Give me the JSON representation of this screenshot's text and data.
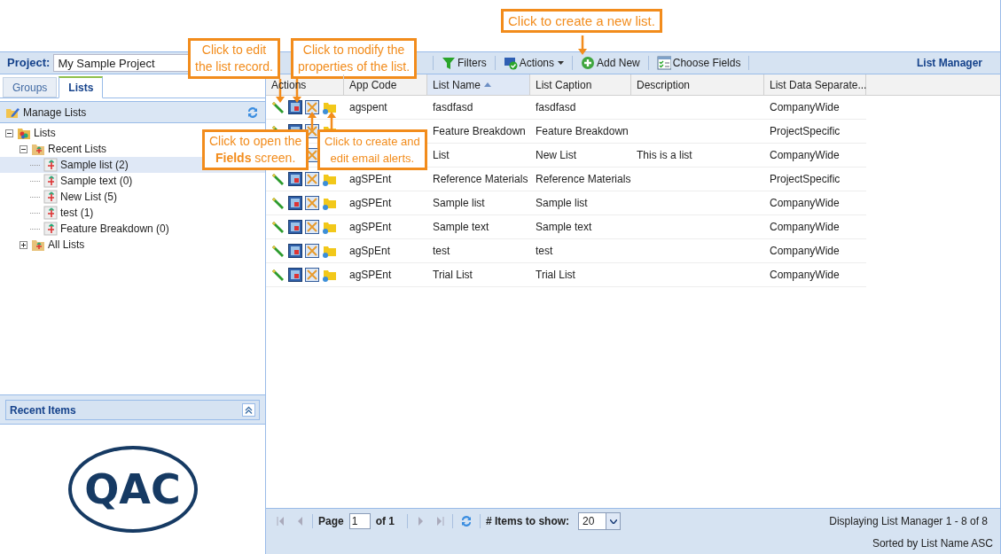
{
  "header": {
    "project_label": "Project:",
    "project_value": "My Sample Project",
    "title": "List Manager",
    "toolbar": [
      {
        "label": "Filters",
        "kind": "filter",
        "dropdown": false
      },
      {
        "label": "Actions",
        "kind": "actions",
        "dropdown": true
      },
      {
        "label": "Add New",
        "kind": "add",
        "dropdown": false
      },
      {
        "label": "Choose Fields",
        "kind": "fields",
        "dropdown": false
      }
    ]
  },
  "tabs": [
    {
      "label": "Groups",
      "selected": false
    },
    {
      "label": "Lists",
      "selected": true
    }
  ],
  "manage_lists": {
    "label": "Manage Lists"
  },
  "tree": [
    {
      "label": "Lists",
      "kind": "root",
      "expanded": true,
      "selected": false,
      "children": [
        {
          "label": "Recent Lists",
          "kind": "folder",
          "expanded": true,
          "selected": false,
          "children": [
            {
              "label": "Sample list (2)",
              "kind": "list",
              "selected": true
            },
            {
              "label": "Sample text (0)",
              "kind": "list",
              "selected": false
            },
            {
              "label": "New List (5)",
              "kind": "list",
              "selected": false
            },
            {
              "label": "test (1)",
              "kind": "list",
              "selected": false
            },
            {
              "label": "Feature Breakdown (0)",
              "kind": "list",
              "selected": false
            }
          ]
        },
        {
          "label": "All Lists",
          "kind": "folder",
          "expanded": false,
          "selected": false
        }
      ]
    }
  ],
  "recent_items": {
    "title": "Recent Items",
    "logo_text": "QAC"
  },
  "grid": {
    "columns": [
      {
        "label": "Actions",
        "sorted": false
      },
      {
        "label": "App Code",
        "sorted": false
      },
      {
        "label": "List Name",
        "sorted": true
      },
      {
        "label": "List Caption",
        "sorted": false
      },
      {
        "label": "Description",
        "sorted": false
      },
      {
        "label": "List Data Separate...",
        "sorted": false
      }
    ],
    "rows": [
      {
        "app_code": "agspent",
        "list_name": "fasdfasd",
        "list_caption": "fasdfasd",
        "separation": "CompanyWide"
      },
      {
        "list_name": "Feature Breakdown",
        "list_caption": "Feature Breakdown",
        "separation": "ProjectSpecific"
      },
      {
        "list_name": "List",
        "list_caption": "New List",
        "description": "This is a list",
        "separation": "CompanyWide"
      },
      {
        "app_code": "agSPEnt",
        "list_name": "Reference Materials",
        "list_caption": "Reference Materials",
        "separation": "ProjectSpecific"
      },
      {
        "app_code": "agSPEnt",
        "list_name": "Sample list",
        "list_caption": "Sample list",
        "separation": "CompanyWide"
      },
      {
        "app_code": "agSPEnt",
        "list_name": "Sample text",
        "list_caption": "Sample text",
        "separation": "CompanyWide"
      },
      {
        "app_code": "agSpEnt",
        "list_name": "test",
        "list_caption": "test",
        "separation": "CompanyWide"
      },
      {
        "app_code": "agSPEnt",
        "list_name": "Trial List",
        "list_caption": "Trial List",
        "separation": "CompanyWide"
      }
    ]
  },
  "paging": {
    "page_label": "Page",
    "page_value": "1",
    "of_label": "of 1",
    "items_label": "# Items to show:",
    "items_value": "20",
    "displaying": "Displaying List Manager 1 - 8 of 8",
    "sorted_by": "Sorted by List Name ASC"
  },
  "callouts": [
    {
      "kind": "edit",
      "lines": [
        "Click to edit",
        "the list record."
      ]
    },
    {
      "kind": "props",
      "lines": [
        "Click to modify the",
        "properties of the list."
      ]
    },
    {
      "kind": "fields",
      "lines": [
        "Click to open the",
        "**Fields** screen."
      ]
    },
    {
      "kind": "alerts",
      "lines": [
        "Click to create and",
        "edit email alerts."
      ]
    },
    {
      "kind": "add",
      "lines": [
        "Click to create a new list."
      ]
    }
  ]
}
